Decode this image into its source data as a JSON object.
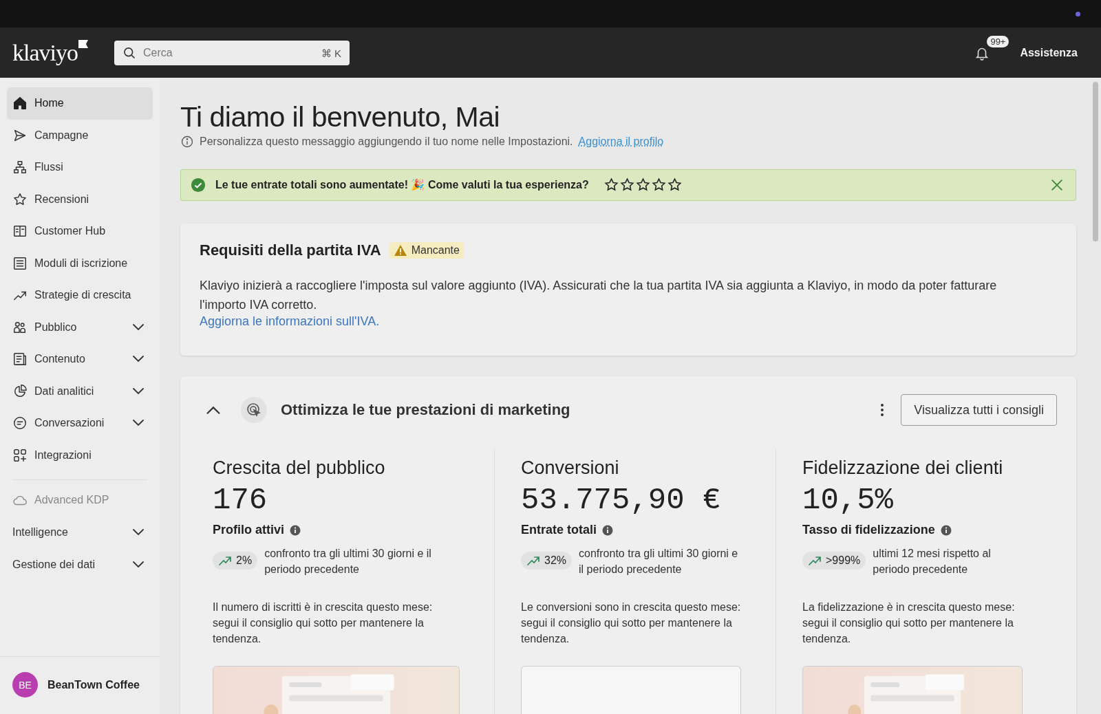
{
  "header": {
    "logo": "klaviyo",
    "search": {
      "placeholder": "Cerca",
      "shortcut": "⌘ K"
    },
    "notifications_badge": "99+",
    "help": "Assistenza"
  },
  "sidebar": {
    "items": [
      {
        "label": "Home",
        "selected": true
      },
      {
        "label": "Campagne",
        "selected": false
      },
      {
        "label": "Flussi",
        "selected": false
      },
      {
        "label": "Recensioni",
        "selected": false
      },
      {
        "label": "Customer Hub",
        "selected": false
      },
      {
        "label": "Moduli di iscrizione",
        "selected": false
      },
      {
        "label": "Strategie di crescita",
        "selected": false
      },
      {
        "label": "Pubblico",
        "selected": false,
        "expanded": false
      },
      {
        "label": "Contenuto",
        "selected": false,
        "expanded": false
      },
      {
        "label": "Dati analitici",
        "selected": false,
        "expanded": false
      },
      {
        "label": "Conversazioni",
        "selected": false,
        "expanded": false
      },
      {
        "label": "Integrazioni",
        "selected": false
      }
    ],
    "app": {
      "label": "Advanced KDP",
      "disabled": true
    },
    "sections": [
      {
        "label": "Intelligence",
        "expanded": false
      },
      {
        "label": "Gestione dei dati",
        "expanded": false
      }
    ],
    "account": {
      "initials": "BE",
      "name": "BeanTown Coffee"
    }
  },
  "main": {
    "title": "Ti diamo il benvenuto, Mai",
    "subtitle": "Personalizza questo messaggio aggiungendo il tuo nome nelle Impostazioni.",
    "subtitle_link": "Aggiorna il profilo",
    "banner": {
      "message": "Le tue entrate totali sono aumentate! 🎉 Come valuti la tua esperienza?",
      "stars": 0
    },
    "vat_card": {
      "title": "Requisiti della partita IVA",
      "badge": "Mancante",
      "body": "Klaviyo inizierà a raccogliere l'imposta sul valore aggiunto (IVA). Assicurati che la tua partita IVA sia aggiunta a Klaviyo, in modo da poter fatturare l'importo IVA corretto.",
      "link": "Aggiorna le informazioni sull'IVA."
    },
    "insights": {
      "title": "Ottimizza le tue prestazioni di marketing",
      "expanded": true,
      "button": "Visualizza tutti i consigli",
      "metrics": [
        {
          "title": "Crescita del pubblico",
          "value": "176",
          "label": "Profilo attivi",
          "change": "2%",
          "comparison": "confronto tra gli ultimi 30 giorni e il periodo precedente",
          "description": "Il numero di iscritti è in crescita questo mese: segui il consiglio qui sotto per mantenere la tendenza."
        },
        {
          "title": "Conversioni",
          "value": "53.775,90 €",
          "label": "Entrate totali",
          "change": "32%",
          "comparison": "confronto tra gli ultimi 30 giorni e il periodo precedente",
          "description": "Le conversioni sono in crescita questo mese: segui il consiglio qui sotto per mantenere la tendenza."
        },
        {
          "title": "Fidelizzazione dei clienti",
          "value": "10,5%",
          "label": "Tasso di fidelizzazione",
          "change": ">999%",
          "comparison": "ultimi 12 mesi rispetto al periodo precedente",
          "description": "La fidelizzazione è in crescita questo mese: segui il consiglio qui sotto per mantenere la tendenza."
        }
      ]
    }
  }
}
